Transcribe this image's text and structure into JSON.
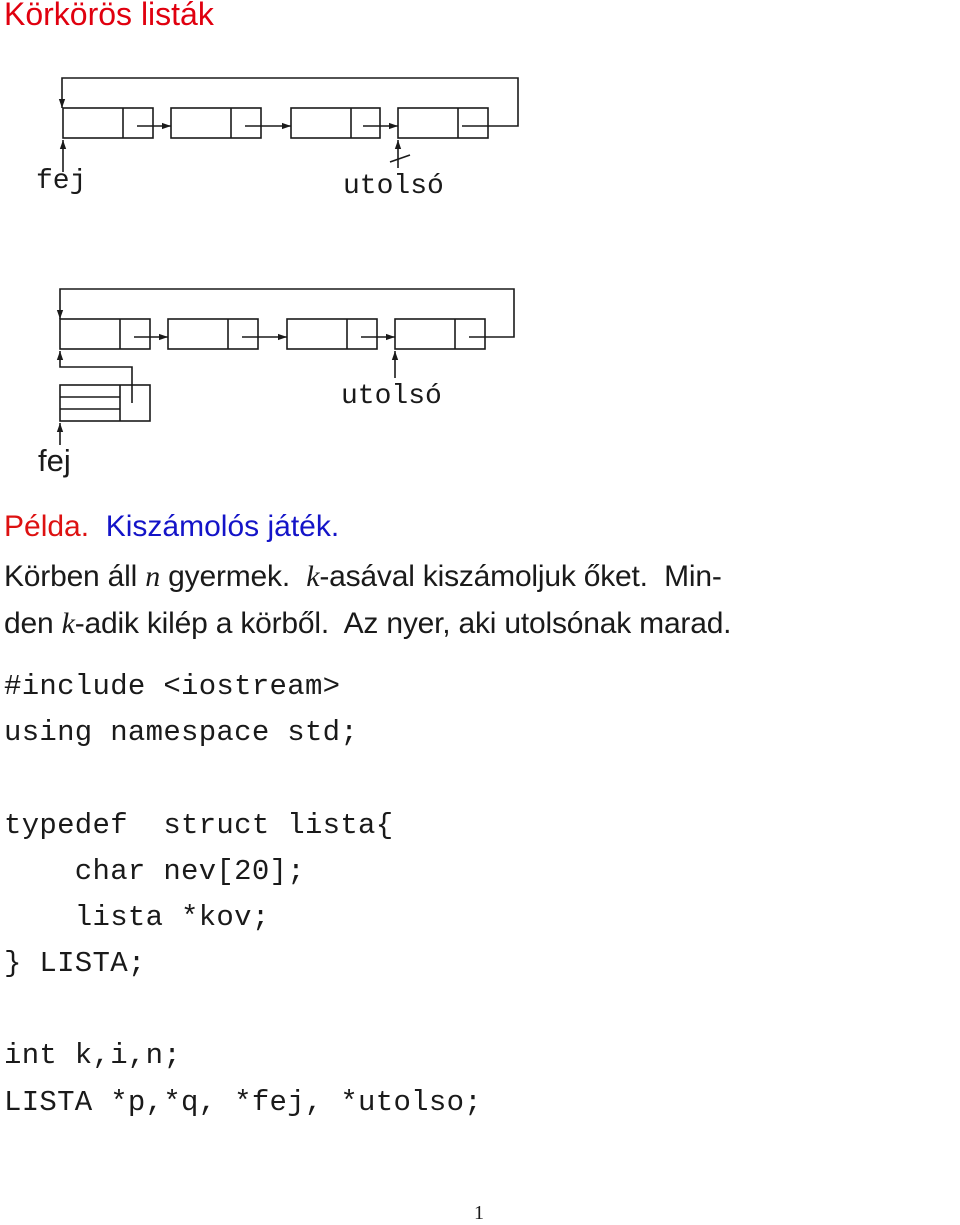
{
  "colors": {
    "title": "#e0000f",
    "example_label": "#dd1111",
    "example_title": "#1414c8",
    "text": "#1a1a1a"
  },
  "title": "Körkörös listák",
  "diagrams": [
    {
      "nodes": 4,
      "labels": {
        "head": "fej",
        "last": "utolsó"
      },
      "last_pointer_crossed": true,
      "has_sentinel": false
    },
    {
      "nodes": 4,
      "labels": {
        "head": "fej",
        "last": "utolsó"
      },
      "last_pointer_crossed": false,
      "has_sentinel": true
    }
  ],
  "example": {
    "label": "Példa.",
    "title": "Kiszámolós játék."
  },
  "paragraph": {
    "line1": [
      "Körben áll ",
      "n",
      " gyermek.  ",
      "k",
      "-asával kiszámoljuk őket.  Min-"
    ],
    "line2": [
      "den ",
      "k",
      "-adik kilép a körből.  Az nyer, aki utolsónak marad."
    ]
  },
  "code": [
    "#include <iostream>",
    "using namespace std;",
    "",
    "typedef  struct lista{",
    "    char nev[20];",
    "    lista *kov;",
    "} LISTA;",
    "",
    "int k,i,n;",
    "LISTA *p,*q, *fej, *utolso;"
  ],
  "page_number": "1"
}
